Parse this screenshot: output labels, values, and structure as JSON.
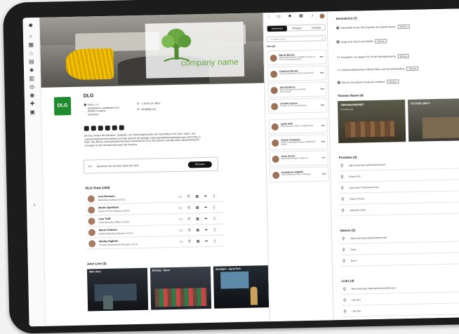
{
  "banner": {
    "company_name": "company name"
  },
  "company": {
    "name": "DLG",
    "logo_text": "DLG",
    "address": [
      "DLG e. V.",
      "Eschborner Landstraße 122",
      "60489 Frankfurt",
      "Germany"
    ],
    "phone": "+ 49 69 24 788-0",
    "email": "info@dlg.org",
    "description": "Die DLG fördert den Wissens-, Qualitäts- und Technologietransfer der Fachkräfte in der Land-, Agrar- und Lebensmittelwirtschaft weltweit und trägt dadurch die globalen Nahrungsmittelherausforderungen mit Erfolg zu lösen. Als offenes, internationales Netzwerk entwickelt die DLG mit Experten aus aller Welt zukunftsweisende Lösungen für die Herausforderungen der Branche.",
    "chat_label": "Sprechen Sie mit dem Team der DLG",
    "chat_button": "Betreten"
  },
  "team": {
    "title": "DLG-Team (100)",
    "members": [
      {
        "name": "Lisa Domann",
        "role": "Marketing Assistant at DLG"
      },
      {
        "name": "Martin Spellman",
        "role": "Head of PR & Relations at DLG"
      },
      {
        "name": "Lisa Tipff",
        "role": "Chief Executive Officer at DLG"
      },
      {
        "name": "Marie Clohsen",
        "role": "Online Marketing Manager at DLG"
      },
      {
        "name": "Marley Eighton",
        "role": "Product Development Manager at DLG"
      }
    ]
  },
  "live": {
    "title": "Jetzt Live (3)",
    "tiles": [
      "Web Ultra",
      "Beitrag - Agrar",
      "Spotlight - AgrarTech"
    ]
  },
  "people_panel": {
    "tabs": [
      "Teilnehmer",
      "Anfragen",
      "Kontakte"
    ],
    "search_placeholder": "Kontakte finden",
    "group_label": "Neu (4)",
    "cards": [
      {
        "name": "Martin Becker",
        "role": "Marketing Assistant at Distillers Norton at Feld und Erzeugerchemie"
      },
      {
        "name": "Charlene Becker",
        "role": "Head of Marketing at DLG Gentech AG"
      },
      {
        "name": "Ana Dockerty",
        "role": "Brand Manager at Landmarke International"
      },
      {
        "name": "Jennifer Hanna",
        "role": "Founder & CTO at Agrarboard"
      },
      {
        "name": "Lydia Tipff",
        "role": "Chief Executive Officer at Agrarboard"
      },
      {
        "name": "Jennie Tempsant",
        "role": "Online Marketing Manager at BIOGATE GmbH"
      },
      {
        "name": "Sean Cortez",
        "role": "Marketing Manager at Agro-Inc."
      },
      {
        "name": "Konstance Salaidie",
        "role": "Chief Marketing Officer at Bungal"
      }
    ]
  },
  "right_panel": {
    "events_title": "Demnächst (7)",
    "events": [
      {
        "text": "Individuelle Fonds: Wie Experten die Zukunft sichern",
        "tag": "Webinar"
      },
      {
        "text": "Junge DLG: Beruf und Vertrieb",
        "tag": "Webinar"
      },
      {
        "text": "Produktinfo: So steigert Sie Ihr die Vertragseinigung",
        "tag": "Webinar"
      },
      {
        "text": "Lebensmittelsicherheit: Aktives Risiko und den Wissensfluss",
        "tag": "Webinar"
      },
      {
        "text": "Wie wir Innovationen heute gut umsetzen",
        "tag": "Webinar"
      }
    ],
    "themes_title": "Themen Raum (4)",
    "themes": [
      {
        "title": "TIERGESUNDHEIT",
        "sub": "Kontaktrunde"
      },
      {
        "title": "FUTTER UND F",
        "sub": ""
      }
    ],
    "products_title": "Produkte (4)",
    "products": [
      "https://www.dlg.org/de/landwirtschaft",
      "Engine Kits",
      "Automotive Transmission Kits",
      "Vitamin Premix",
      "Hydraulic Fluids"
    ],
    "names_title": "Namen (3)",
    "names": [
      "https://www.dlg.org/de/landwirtschaft",
      "Name",
      "Name"
    ],
    "links_title": "Links (4)",
    "links": [
      "https://www.dlg.org/de/landwirtschaft/themen",
      "Link Titel",
      "Link Titel"
    ]
  }
}
